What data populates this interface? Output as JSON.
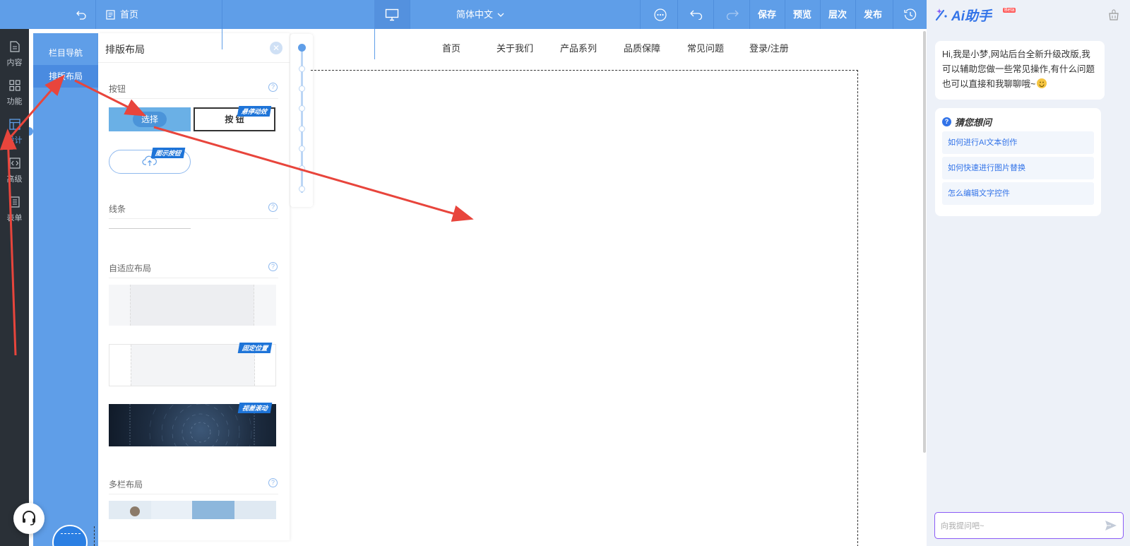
{
  "topbar": {
    "page_name": "首页",
    "language": "简体中文",
    "save": "保存",
    "preview": "预览",
    "layers": "层次",
    "publish": "发布"
  },
  "left_sidebar": {
    "items": [
      {
        "label": "内容",
        "icon": "document-icon"
      },
      {
        "label": "功能",
        "icon": "grid-icon"
      },
      {
        "label": "设计",
        "icon": "layout-icon"
      },
      {
        "label": "高级",
        "icon": "code-icon"
      },
      {
        "label": "表单",
        "icon": "form-icon"
      }
    ],
    "active": "设计"
  },
  "sub_nav": {
    "items": [
      "栏目导航",
      "排版布局"
    ],
    "active": "排版布局"
  },
  "panel": {
    "title": "排版布局",
    "sections": {
      "button": "按钮",
      "line": "线条",
      "adaptive": "自适应布局",
      "multicol": "多栏布局"
    },
    "button_samples": {
      "select_label": "选择",
      "outline_label": "按 钮",
      "tag_hover": "悬停动效",
      "tag_icon": "图示按钮"
    },
    "layout_tags": {
      "fixed": "固定位置",
      "parallax": "视差滚动"
    }
  },
  "canvas": {
    "nav": [
      "首页",
      "关于我们",
      "产品系列",
      "品质保障",
      "常见问题",
      "登录/注册"
    ]
  },
  "ai_panel": {
    "title": "Ai助手",
    "beta": "Beta",
    "greeting": "Hi,我是小梦,网站后台全新升级改版,我可以辅助您做一些常见操作,有什么问题也可以直接和我聊聊哦~",
    "guess_title": "猜您想问",
    "questions": [
      "如何进行AI文本创作",
      "如何快速进行图片替换",
      "怎么编辑文字控件"
    ],
    "input_placeholder": "向我提问吧~"
  },
  "colors": {
    "primary": "#5f9ee8",
    "sidebar": "#2a3037",
    "annotation": "#e8453c",
    "ai_accent": "#3273e8"
  }
}
